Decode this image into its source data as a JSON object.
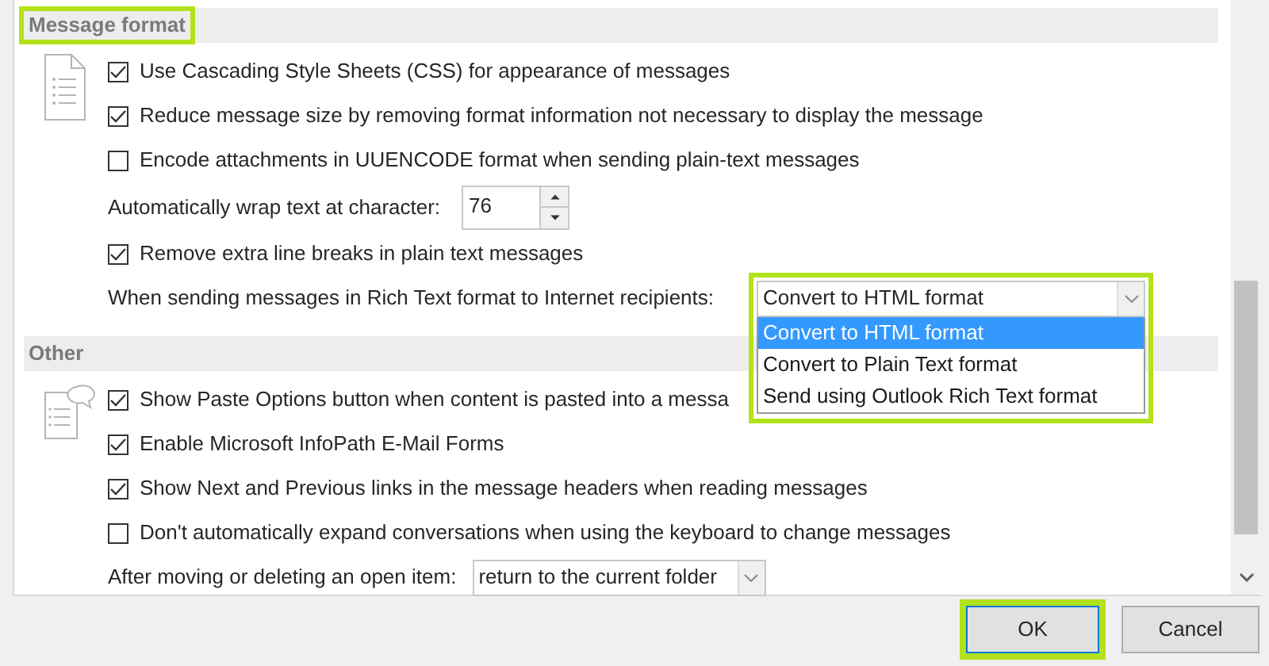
{
  "sections": [
    {
      "title": "Message format",
      "highlighted": true,
      "items": [
        {
          "kind": "checkbox",
          "label": "Use Cascading Style Sheets (CSS) for appearance of messages",
          "checked": true
        },
        {
          "kind": "checkbox",
          "label": "Reduce message size by removing format information not necessary to display the message",
          "checked": true
        },
        {
          "kind": "checkbox",
          "label": "Encode attachments in UUENCODE format when sending plain-text messages",
          "checked": false
        },
        {
          "kind": "spinner",
          "label": "Automatically wrap text at character:",
          "value": "76"
        },
        {
          "kind": "checkbox",
          "label": "Remove extra line breaks in plain text messages",
          "checked": true
        },
        {
          "kind": "dropdown",
          "label": "When sending messages in Rich Text format to Internet recipients:",
          "value": "Convert to HTML format",
          "expanded": true,
          "highlighted": true,
          "options": [
            {
              "label": "Convert to HTML format",
              "selected": true
            },
            {
              "label": "Convert to Plain Text format",
              "selected": false
            },
            {
              "label": "Send using Outlook Rich Text format",
              "selected": false
            }
          ]
        }
      ]
    },
    {
      "title": "Other",
      "highlighted": false,
      "items": [
        {
          "kind": "checkbox",
          "label": "Show Paste Options button when content is pasted into a messa",
          "checked": true
        },
        {
          "kind": "checkbox",
          "label": "Enable Microsoft InfoPath E-Mail Forms",
          "checked": true
        },
        {
          "kind": "checkbox",
          "label": "Show Next and Previous links in the message headers when reading messages",
          "checked": true
        },
        {
          "kind": "checkbox",
          "label": "Don't automatically expand conversations when using the keyboard to change messages",
          "checked": false
        },
        {
          "kind": "dropdown",
          "label": "After moving or deleting an open item:",
          "value": "return to the current folder"
        }
      ]
    }
  ],
  "buttons": [
    {
      "label": "OK",
      "highlighted": true
    },
    {
      "label": "Cancel",
      "highlighted": false
    }
  ]
}
